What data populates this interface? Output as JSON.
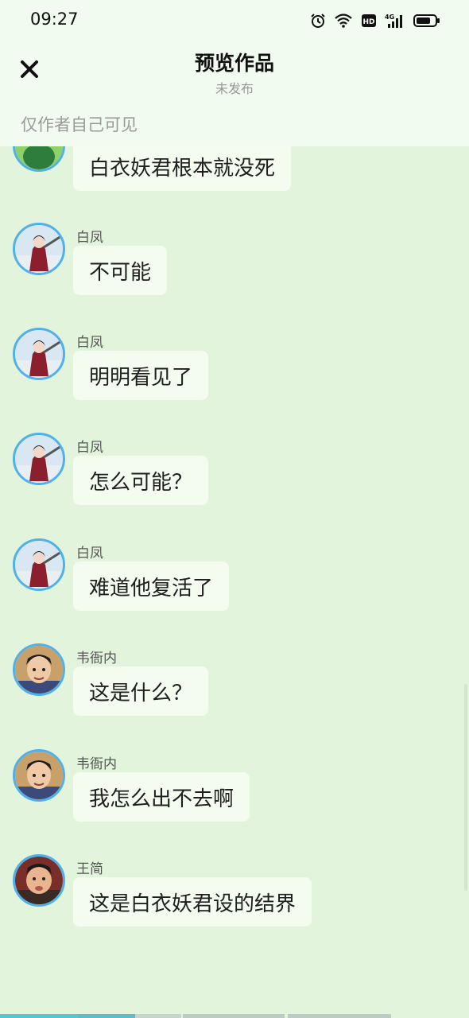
{
  "status_bar": {
    "time": "09:27"
  },
  "header": {
    "close_icon": "close-icon",
    "title": "预览作品",
    "subtitle": "未发布",
    "visibility_note": "仅作者自己可见"
  },
  "messages": [
    {
      "name": "",
      "text": "白衣妖君根本就没死",
      "avatar": "green-avatar"
    },
    {
      "name": "白凤",
      "text": "不可能",
      "avatar": "baifeng-avatar"
    },
    {
      "name": "白凤",
      "text": "明明看见了",
      "avatar": "baifeng-avatar"
    },
    {
      "name": "白凤",
      "text": "怎么可能？",
      "avatar": "baifeng-avatar"
    },
    {
      "name": "白凤",
      "text": "难道他复活了",
      "avatar": "baifeng-avatar"
    },
    {
      "name": "韦衙内",
      "text": "这是什么？",
      "avatar": "weiyanei-avatar"
    },
    {
      "name": "韦衙内",
      "text": "我怎么出不去啊",
      "avatar": "weiyanei-avatar"
    },
    {
      "name": "王简",
      "text": "这是白衣妖君设的结界",
      "avatar": "wangjian-avatar"
    }
  ],
  "colors": {
    "background": "#e3f4dc",
    "header_background": "#f2fbef",
    "bubble": "#f4fbef",
    "avatar_border": "#4fb1ea"
  }
}
